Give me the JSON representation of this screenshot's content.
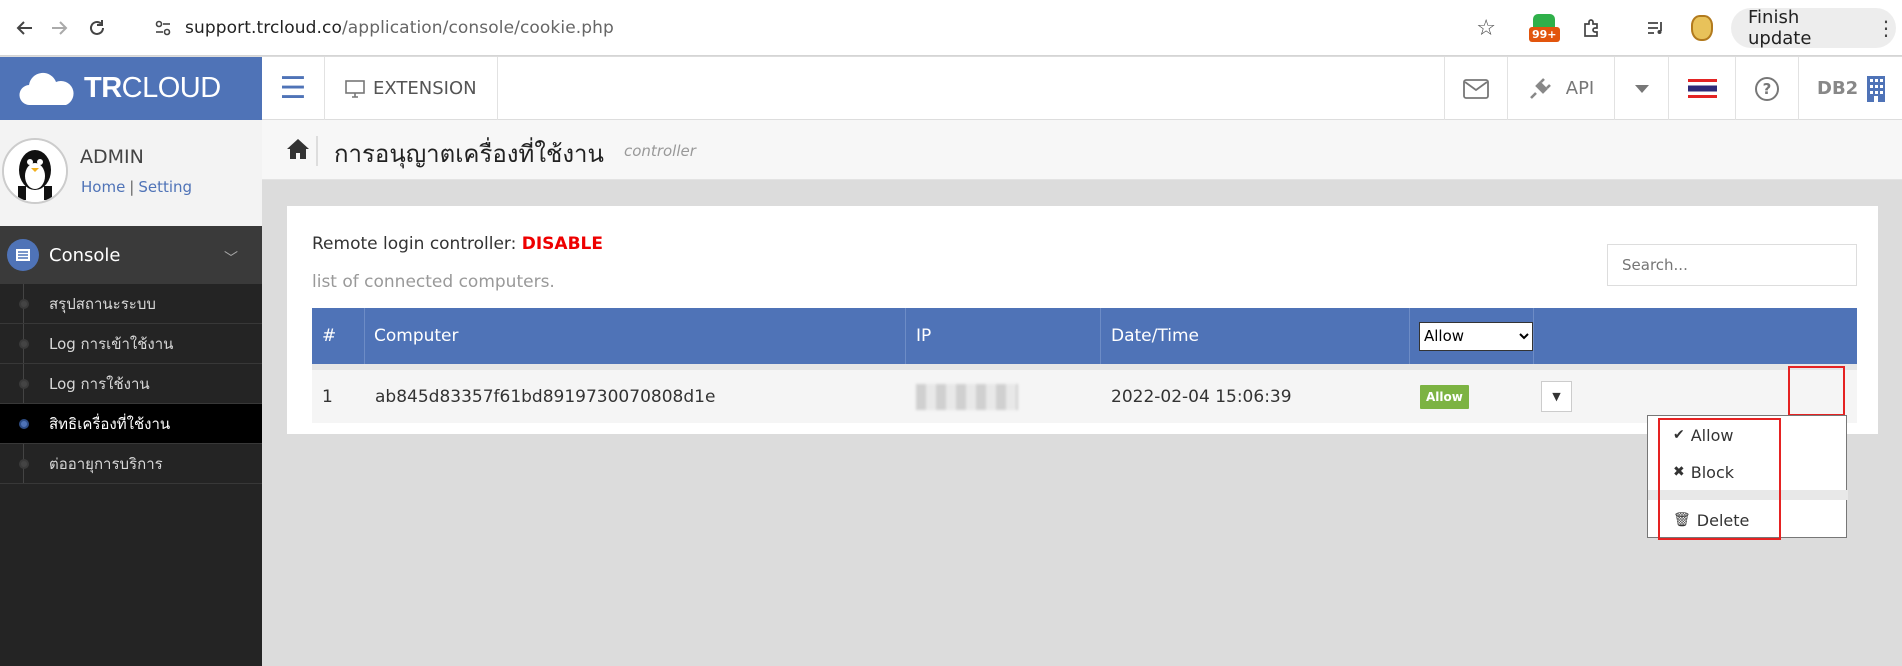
{
  "browser": {
    "url_host": "support.trcloud.co",
    "url_path": "/application/console/cookie.php",
    "ext_badge": "99+",
    "finish_update_label": "Finish update"
  },
  "topbar": {
    "logo_bold": "TR",
    "logo_light": "CLOUD",
    "extension_label": "EXTENSION",
    "api_label": "API",
    "db_label": "DB2"
  },
  "sidebar": {
    "user_name": "ADMIN",
    "home_link": "Home",
    "separator": "|",
    "setting_link": "Setting",
    "section_label": "Console",
    "items": [
      {
        "label": "สรุปสถานะระบบ",
        "active": false
      },
      {
        "label": "Log การเข้าใช้งาน",
        "active": false
      },
      {
        "label": "Log การใช้งาน",
        "active": false
      },
      {
        "label": "สิทธิเครื่องที่ใช้งาน",
        "active": true
      },
      {
        "label": "ต่ออายุการบริการ",
        "active": false
      }
    ]
  },
  "page": {
    "title": "การอนุญาตเครื่องที่ใช้งาน",
    "subtitle": "controller"
  },
  "panel": {
    "remote_label": "Remote login controller: ",
    "remote_status": "DISABLE",
    "list_label": "list of connected computers.",
    "search_placeholder": "Search..."
  },
  "table": {
    "headers": {
      "num": "#",
      "computer": "Computer",
      "ip": "IP",
      "datetime": "Date/Time"
    },
    "filter_selected": "Allow",
    "rows": [
      {
        "num": "1",
        "computer": "ab845d83357f61bd8919730070808d1e",
        "datetime": "2022-02-04 15:06:39",
        "status": "Allow"
      }
    ]
  },
  "dropdown": {
    "allow": "Allow",
    "block": "Block",
    "delete": "Delete"
  },
  "colors": {
    "brand_blue": "#4f73b7",
    "status_disable": "#ee0000",
    "badge_allow": "#7cb342",
    "highlight_red": "#e52222"
  }
}
